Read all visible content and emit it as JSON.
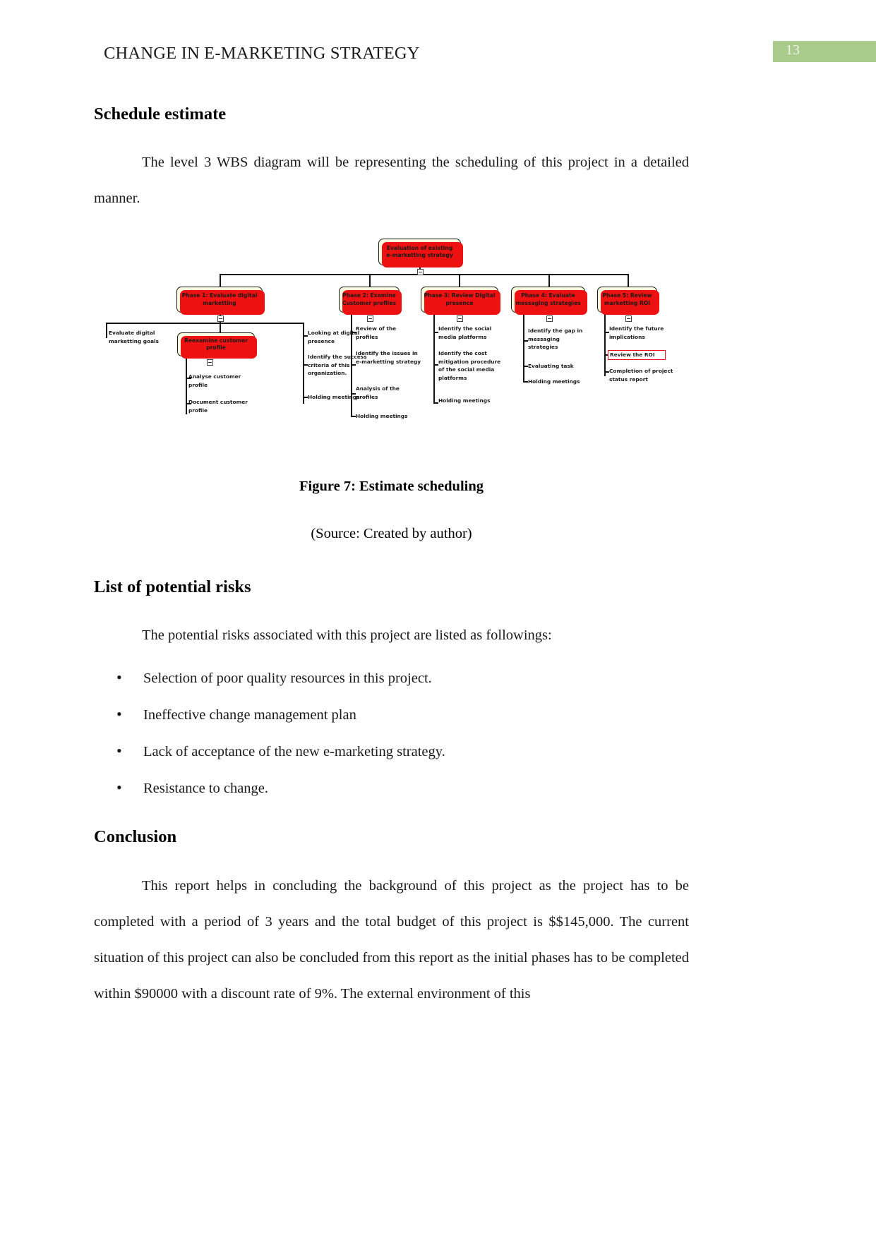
{
  "header": {
    "title": "CHANGE IN E-MARKETING STRATEGY",
    "page_number": "13",
    "badge_color": "#a9cb8c"
  },
  "sections": {
    "schedule_heading": "Schedule estimate",
    "schedule_para": "The level 3 WBS diagram will be representing the scheduling of this project in a detailed manner.",
    "figure_caption": "Figure 7: Estimate scheduling",
    "figure_source": "(Source: Created by author)",
    "risks_heading": "List of potential risks",
    "risks_intro": "The potential risks associated with this project are listed as followings:",
    "risks": [
      "Selection of poor quality resources in this project.",
      "Ineffective change management plan",
      "Lack of acceptance of the new e-marketing strategy.",
      "Resistance to change."
    ],
    "conclusion_heading": "Conclusion",
    "conclusion_para": "This report helps in concluding the background of this project as the project has to be completed with a period of 3 years and the total budget of this project is $$145,000. The current situation of this project can also be concluded from this report as the initial phases has to be completed within $90000 with a discount rate of 9%. The external environment of this"
  },
  "diagram": {
    "root": "Evaluation of existing\ne-marketting strategy",
    "phases": [
      {
        "title": "Phase 1: Evaluate digital\nmarketting"
      },
      {
        "title": "Phase 2: Examine\nCustomer profiles"
      },
      {
        "title": "Phase 3: Review Digital\npresence"
      },
      {
        "title": "Phase 4: Evaluate\nmessaging strategies"
      },
      {
        "title": "Phase 5: Review\nmarketting ROI"
      }
    ],
    "subnode": "Reexamine customer\nprofile",
    "leaves": {
      "p1_goal": "Evaluate digital\nmarketting goals",
      "p1_a": "Analyse customer\nprofile",
      "p1_b": "Document customer\nprofile",
      "p1_c": "Looking at digital\npresence",
      "p1_d": "Identify the success\ncriteria of this\norganization.",
      "p1_e": "Holding meetings",
      "p2_a": "Review of the\nprofiles",
      "p2_b": "Identify the issues in\ne-marketting strategy",
      "p2_c": "Analysis of the\nprofiles",
      "p2_d": "Holding meetings",
      "p3_a": "Identify the social\nmedia platforms",
      "p3_b": "Identify the cost\nmitigation procedure\nof the social media\nplatforms",
      "p3_c": "Holding meetings",
      "p4_a": "Identify the gap in\nmessaging\nstrategies",
      "p4_b": "Evaluating task",
      "p4_c": "Holding meetings",
      "p5_a": "Identify the future\nimplications",
      "p5_b": "Review the ROI",
      "p5_c": "Completion of project\nstatus report"
    }
  }
}
